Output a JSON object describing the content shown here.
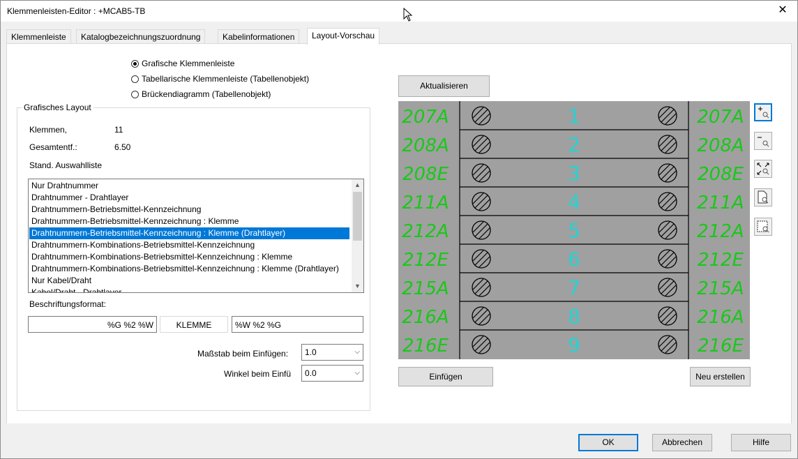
{
  "window": {
    "title": "Klemmenleisten-Editor : +MCAB5-TB",
    "close_glyph": "✕"
  },
  "tabs": [
    {
      "label": "Klemmenleiste"
    },
    {
      "label": "Katalogbezeichnungszuordnung"
    },
    {
      "label": "Kabelinformationen"
    },
    {
      "label": "Layout-Vorschau",
      "active": true
    }
  ],
  "layout_type": {
    "options": [
      {
        "label": "Grafische Klemmenleiste",
        "checked": true
      },
      {
        "label": "Tabellarische Klemmenleiste (Tabellenobjekt)",
        "checked": false
      },
      {
        "label": "Brückendiagramm (Tabellenobjekt)",
        "checked": false
      }
    ]
  },
  "graphic_layout": {
    "group_title": "Grafisches Layout",
    "klemmen_label": "Klemmen,",
    "klemmen_value": "11",
    "gesamt_label": "Gesamtentf.:",
    "gesamt_value": "6.50",
    "pick_list_label": "Stand. Auswahlliste",
    "pick_list": [
      "Nur Drahtnummer",
      "Drahtnummer - Drahtlayer",
      "Drahtnummern-Betriebsmittel-Kennzeichnung",
      "Drahtnummern-Betriebsmittel-Kennzeichnung : Klemme",
      "Drahtnummern-Betriebsmittel-Kennzeichnung : Klemme (Drahtlayer)",
      "Drahtnummern-Kombinations-Betriebsmittel-Kennzeichnung",
      "Drahtnummern-Kombinations-Betriebsmittel-Kennzeichnung : Klemme",
      "Drahtnummern-Kombinations-Betriebsmittel-Kennzeichnung : Klemme (Drahtlayer)",
      "Nur Kabel/Draht",
      "Kabel/Draht - Drahtlayer"
    ],
    "pick_list_selected_index": 4,
    "format_label": "Beschriftungsformat:",
    "format_left": "%G %2 %W",
    "format_middle": "KLEMME",
    "format_right": "%W %2 %G",
    "scale_label": "Maßstab beim Einfügen:",
    "scale_value": "1.0",
    "angle_label": "Winkel beim Einfü",
    "angle_value": "0.0"
  },
  "preview": {
    "refresh_button": "Aktualisieren",
    "insert_button": "Einfügen",
    "rebuild_button": "Neu erstellen",
    "rows": [
      {
        "left": "207A",
        "number": "1",
        "right": "207A"
      },
      {
        "left": "208A",
        "number": "2",
        "right": "208A"
      },
      {
        "left": "208E",
        "number": "3",
        "right": "208E"
      },
      {
        "left": "211A",
        "number": "4",
        "right": "211A"
      },
      {
        "left": "212A",
        "number": "5",
        "right": "212A"
      },
      {
        "left": "212E",
        "number": "6",
        "right": "212E"
      },
      {
        "left": "215A",
        "number": "7",
        "right": "215A"
      },
      {
        "left": "216A",
        "number": "8",
        "right": "216A"
      },
      {
        "left": "216E",
        "number": "9",
        "right": "216E"
      }
    ],
    "colors": {
      "background": "#a0a0a0",
      "wire_label": "#19c819",
      "terminal_number": "#22d4d4",
      "line": "#000000"
    },
    "tools": [
      "zoom-in-icon",
      "zoom-out-icon",
      "zoom-extents-icon",
      "zoom-window-icon",
      "zoom-previous-icon"
    ]
  },
  "footer": {
    "ok": "OK",
    "cancel": "Abbrechen",
    "help": "Hilfe"
  }
}
